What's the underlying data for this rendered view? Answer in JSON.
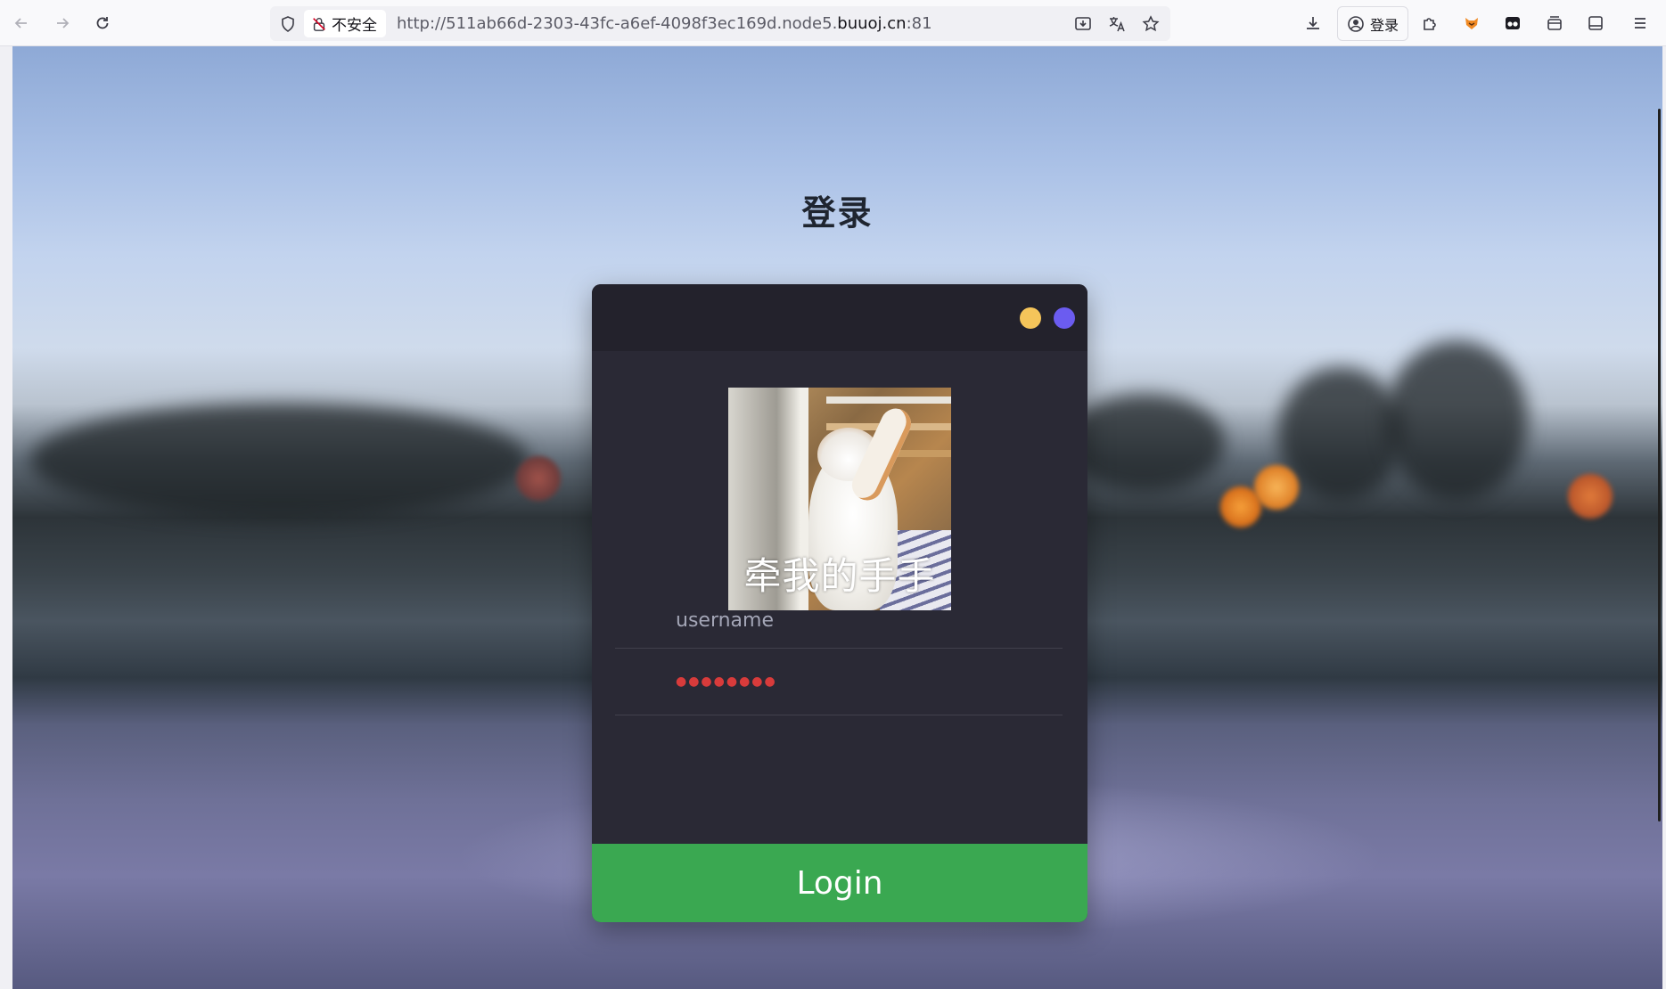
{
  "browser": {
    "nav": {
      "back_icon": "arrow-left-icon",
      "forward_icon": "arrow-right-icon",
      "reload_icon": "reload-icon"
    },
    "security_label": "不安全",
    "url_prefix": "http://511ab66d-2303-43fc-a6ef-4098f3ec169d.node5.",
    "url_host": "buuoj.cn",
    "url_suffix": ":81",
    "account_label": "登录"
  },
  "page": {
    "title": "登录",
    "card": {
      "window_dots": [
        "#f5c55a",
        "#6b5cf0"
      ],
      "image_caption": "牵我的手手",
      "username_placeholder": "username",
      "password_value": "●●●●●●●●",
      "login_label": "Login"
    }
  },
  "colors": {
    "card_bg": "#2a2935",
    "card_header": "#23222c",
    "login_button": "#3aa851",
    "password_dots": "#d83b3b"
  }
}
